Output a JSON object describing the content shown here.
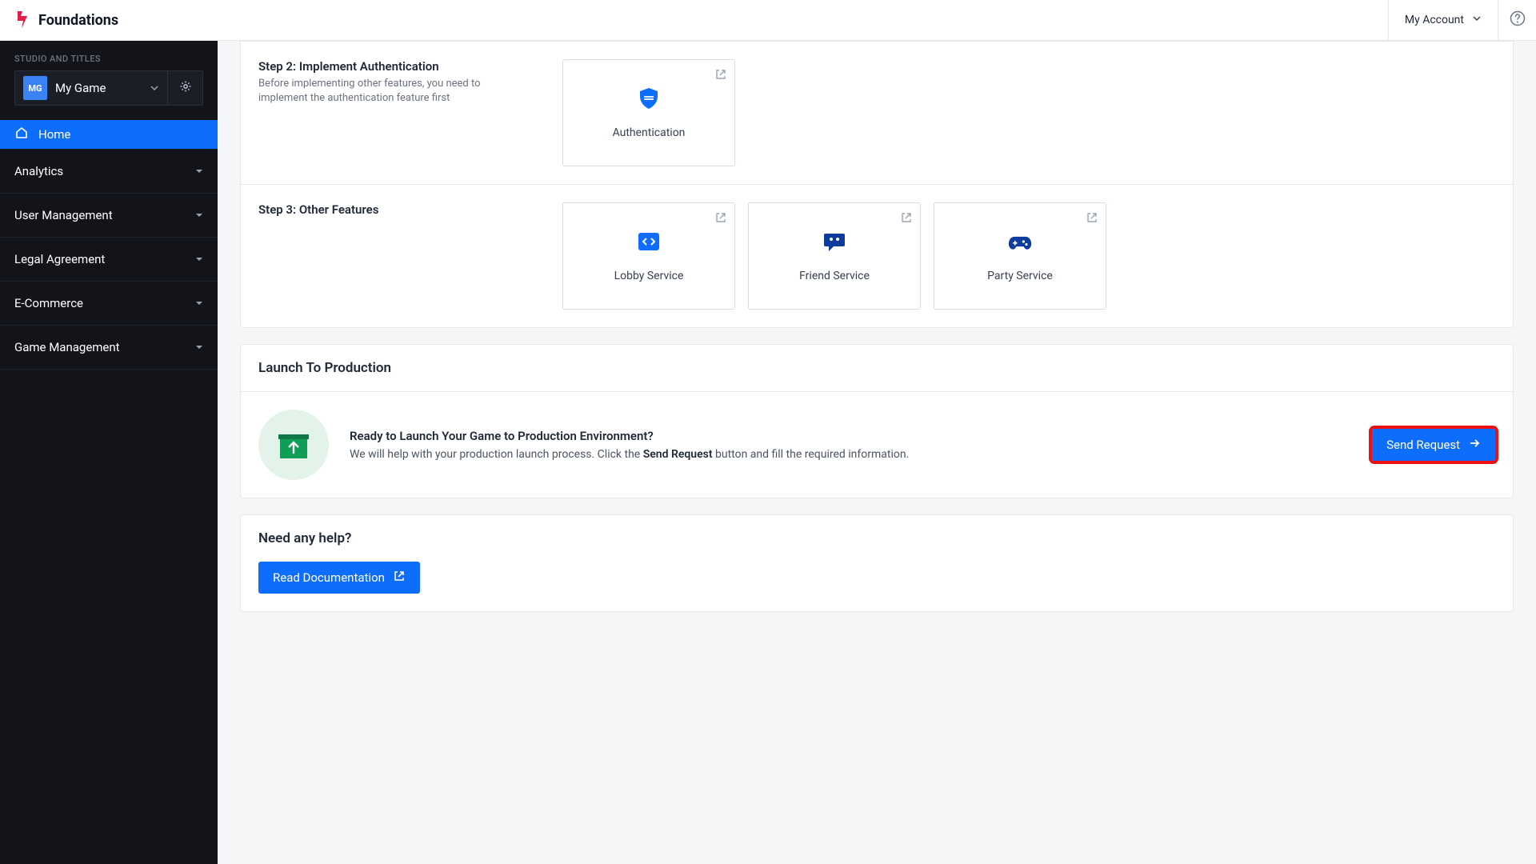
{
  "brand": {
    "name": "Foundations"
  },
  "topbar": {
    "account_label": "My Account"
  },
  "sidebar": {
    "studio_label": "STUDIO AND TITLES",
    "title_badge": "MG",
    "title_name": "My Game",
    "nav": {
      "home": "Home",
      "analytics": "Analytics",
      "user_management": "User Management",
      "legal": "Legal Agreement",
      "ecommerce": "E-Commerce",
      "game_management": "Game Management"
    }
  },
  "steps": {
    "step2": {
      "title": "Step 2: Implement Authentication",
      "desc": "Before implementing other features, you need to implement the authentication feature first",
      "cards": {
        "auth": "Authentication"
      }
    },
    "step3": {
      "title": "Step 3: Other Features",
      "cards": {
        "lobby": "Lobby Service",
        "friend": "Friend Service",
        "party": "Party Service"
      }
    }
  },
  "launch": {
    "section_title": "Launch To Production",
    "headline": "Ready to Launch Your Game to Production Environment?",
    "sub_pre": "We will help with your production launch process. Click the ",
    "sub_strong": "Send Request",
    "sub_post": " button and fill the required information.",
    "button": "Send Request"
  },
  "help": {
    "section_title": "Need any help?",
    "button": "Read Documentation"
  }
}
